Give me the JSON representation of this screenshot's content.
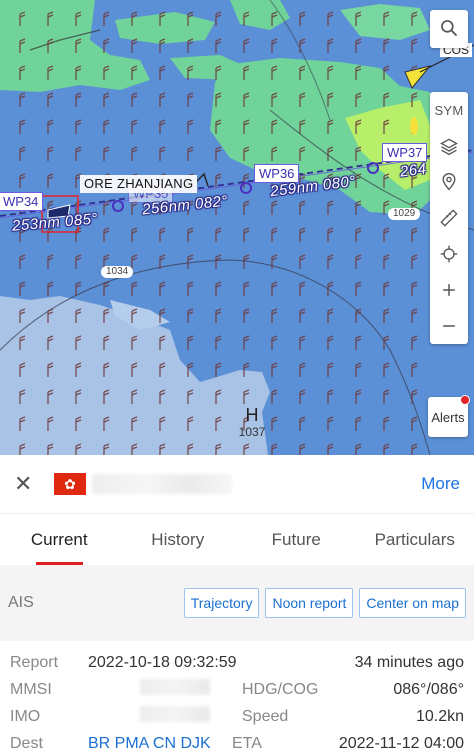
{
  "map": {
    "search_icon": "search-icon",
    "sym_label": "SYM",
    "alerts_label": "Alerts",
    "waypoints": [
      {
        "id": "wp34",
        "label": "WP34"
      },
      {
        "id": "wp35",
        "label": "WP35"
      },
      {
        "id": "wp36",
        "label": "WP36"
      },
      {
        "id": "wp37",
        "label": "WP37"
      }
    ],
    "ship_label": "ORE ZHANJIANG",
    "legs": [
      {
        "id": "leg1",
        "label": "253nm 085°"
      },
      {
        "id": "leg2",
        "label": "256nm 082°"
      },
      {
        "id": "leg3",
        "label": "259nm 080°"
      },
      {
        "id": "leg4",
        "label": "264"
      }
    ],
    "isobars": [
      "1034",
      "1029"
    ],
    "high_pressure": {
      "letter": "H",
      "value": "1037"
    },
    "other_vessel_label": "COS"
  },
  "panel": {
    "close_label": "✕",
    "flag_symbol": "✿",
    "more_label": "More",
    "tabs": [
      "Current",
      "History",
      "Future",
      "Particulars"
    ],
    "active_tab": "Current",
    "ais_label": "AIS",
    "ais_buttons": [
      "Trajectory",
      "Noon report",
      "Center on map"
    ],
    "info": {
      "report_label": "Report",
      "report_value": "2022-10-18 09:32:59",
      "report_ago": "34 minutes ago",
      "mmsi_label": "MMSI",
      "hdg_label": "HDG/COG",
      "hdg_value": "086°/086°",
      "imo_label": "IMO",
      "speed_label": "Speed",
      "speed_value": "10.2kn",
      "dest_label": "Dest",
      "dest_value": "BR PMA CN DJK",
      "eta_label": "ETA",
      "eta_value": "2022-11-12 04:00"
    }
  },
  "colors": {
    "sea": "#5b8fd6",
    "land": "#a9c3e6",
    "rain_light": "#6fd39a",
    "rain_heavy": "#b7ee6a",
    "route": "#6c5ae0",
    "accent": "#e02020",
    "link": "#1a6fd3"
  }
}
